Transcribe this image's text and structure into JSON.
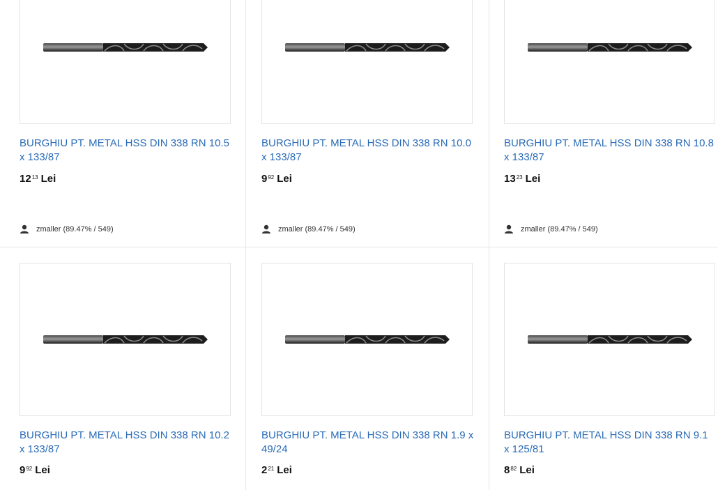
{
  "products": [
    {
      "title": "BURGHIU PT. METAL HSS DIN 338 RN 10.5 x 133/87",
      "price_int": "12",
      "price_dec": "13",
      "currency": "Lei",
      "seller": "zmaller (89.47% / 549)"
    },
    {
      "title": "BURGHIU PT. METAL HSS DIN 338 RN 10.0 x 133/87",
      "price_int": "9",
      "price_dec": "92",
      "currency": "Lei",
      "seller": "zmaller (89.47% / 549)"
    },
    {
      "title": "BURGHIU PT. METAL HSS DIN 338 RN 10.8 x 133/87",
      "price_int": "13",
      "price_dec": "23",
      "currency": "Lei",
      "seller": "zmaller (89.47% / 549)"
    },
    {
      "title": "BURGHIU PT. METAL HSS DIN 338 RN 10.2 x 133/87",
      "price_int": "9",
      "price_dec": "92",
      "currency": "Lei"
    },
    {
      "title": "BURGHIU PT. METAL HSS DIN 338 RN 1.9 x 49/24",
      "price_int": "2",
      "price_dec": "21",
      "currency": "Lei"
    },
    {
      "title": "BURGHIU PT. METAL HSS DIN 338 RN 9.1 x 125/81",
      "price_int": "8",
      "price_dec": "82",
      "currency": "Lei"
    }
  ],
  "icons": {
    "seller": "user-icon"
  },
  "colors": {
    "link": "#2a6bb7",
    "price": "#111111",
    "border": "#e3e3e3"
  }
}
